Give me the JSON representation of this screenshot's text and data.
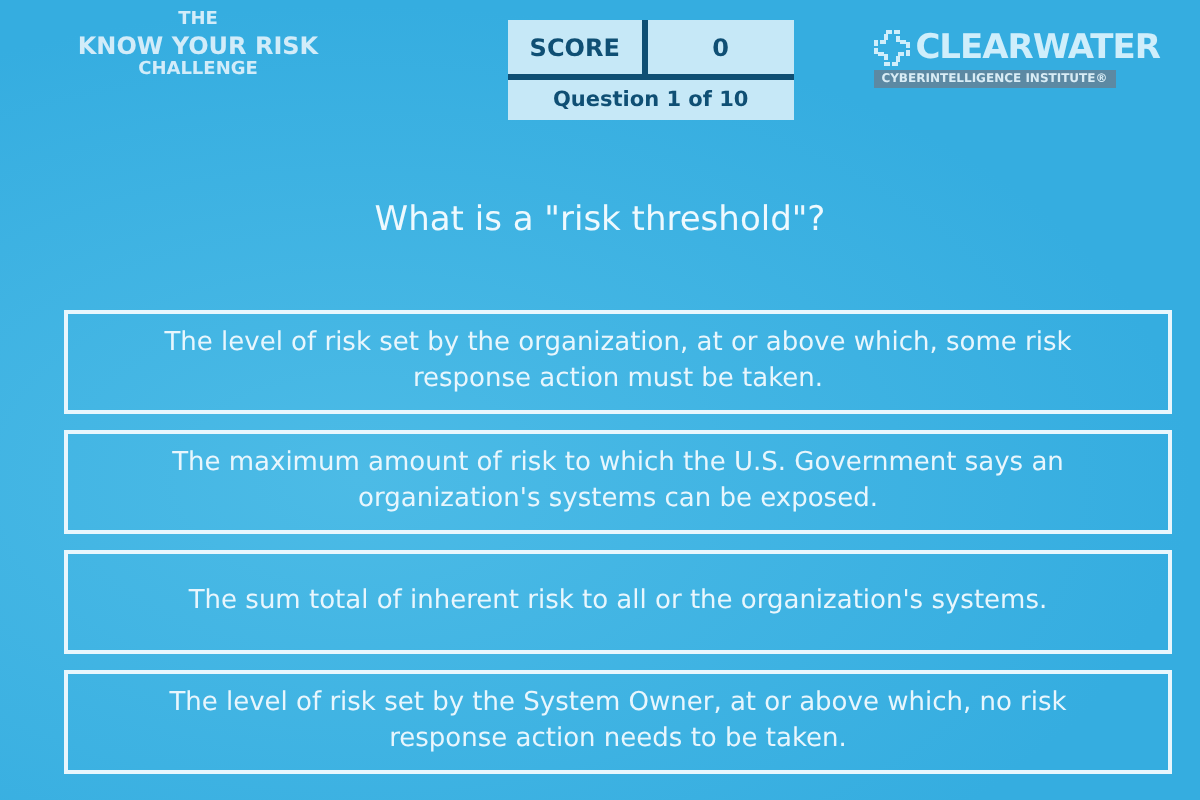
{
  "title": {
    "line_1": "THE",
    "line_2": "KNOW YOUR RISK",
    "line_3": "CHALLENGE"
  },
  "score": {
    "label": "SCORE",
    "value": "0",
    "progress": "Question 1 of 10"
  },
  "logo": {
    "name": "CLEARWATER",
    "tagline": "CYBERINTELLIGENCE INSTITUTE®"
  },
  "question": "What is a \"risk threshold\"?",
  "answers": [
    {
      "text": "The level of risk set by the organization, at or above which, some risk response action must be taken."
    },
    {
      "text": "The maximum amount of risk to which the U.S. Government says an organization's systems can be exposed."
    },
    {
      "text": "The sum total of inherent risk to all or the organization's systems."
    },
    {
      "text": "The level of risk set by the System Owner, at or above which, no risk response action needs to be taken."
    }
  ]
}
